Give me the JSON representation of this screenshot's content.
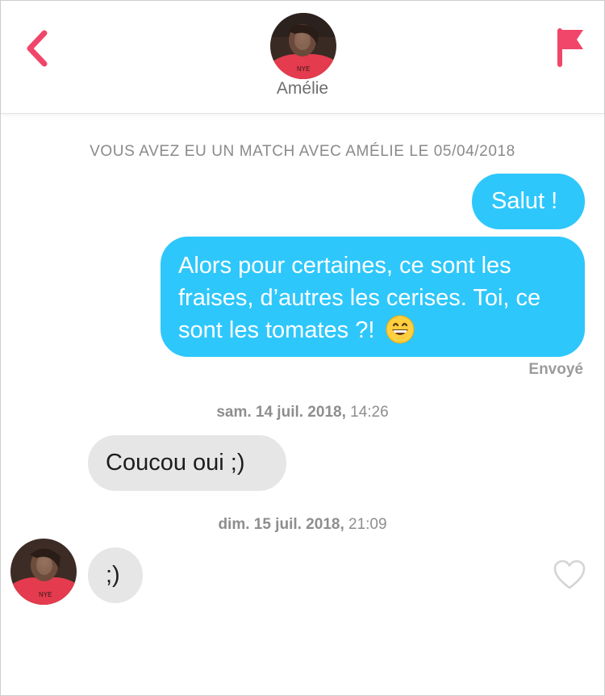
{
  "header": {
    "contact_name": "Amélie",
    "back_icon": "chevron-left-icon",
    "report_icon": "flag-icon",
    "accent_color": "#f1456a"
  },
  "conversation": {
    "match_notice": "VOUS AVEZ EU UN MATCH AVEC AMÉLIE LE 05/04/2018",
    "messages": [
      {
        "direction": "outgoing",
        "text": "Salut !"
      },
      {
        "direction": "outgoing",
        "text": "Alors pour certaines, ce sont les fraises, d’autres les cerises. Toi, ce sont les tomates ?!",
        "emoji": "grinning-face-icon"
      },
      {
        "direction": "incoming",
        "text": "Coucou oui ;)"
      },
      {
        "direction": "incoming",
        "text": ";)"
      }
    ],
    "sent_status": "Envoyé",
    "timestamps": [
      {
        "date": "sam. 14 juil. 2018,",
        "time": "14:26"
      },
      {
        "date": "dim. 15 juil. 2018,",
        "time": "21:09"
      }
    ],
    "like_icon": "heart-outline-icon",
    "outgoing_color": "#2ec7fb",
    "incoming_color": "#e6e6e6"
  }
}
